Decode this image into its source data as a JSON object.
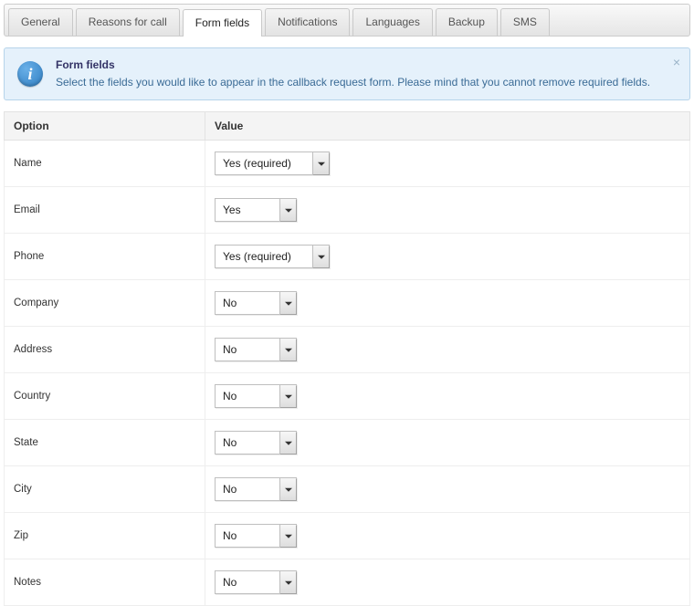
{
  "tabs": [
    {
      "label": "General"
    },
    {
      "label": "Reasons for call"
    },
    {
      "label": "Form fields",
      "active": true
    },
    {
      "label": "Notifications"
    },
    {
      "label": "Languages"
    },
    {
      "label": "Backup"
    },
    {
      "label": "SMS"
    }
  ],
  "info": {
    "title": "Form fields",
    "text": "Select the fields you would like to appear in the callback request form. Please mind that you cannot remove required fields.",
    "close_glyph": "×"
  },
  "table": {
    "headers": {
      "option": "Option",
      "value": "Value"
    },
    "rows": [
      {
        "option": "Name",
        "value": "Yes (required)",
        "width": "wide"
      },
      {
        "option": "Email",
        "value": "Yes",
        "width": "narrow"
      },
      {
        "option": "Phone",
        "value": "Yes (required)",
        "width": "wide"
      },
      {
        "option": "Company",
        "value": "No",
        "width": "narrow"
      },
      {
        "option": "Address",
        "value": "No",
        "width": "narrow"
      },
      {
        "option": "Country",
        "value": "No",
        "width": "narrow"
      },
      {
        "option": "State",
        "value": "No",
        "width": "narrow"
      },
      {
        "option": "City",
        "value": "No",
        "width": "narrow"
      },
      {
        "option": "Zip",
        "value": "No",
        "width": "narrow"
      },
      {
        "option": "Notes",
        "value": "No",
        "width": "narrow"
      }
    ]
  }
}
